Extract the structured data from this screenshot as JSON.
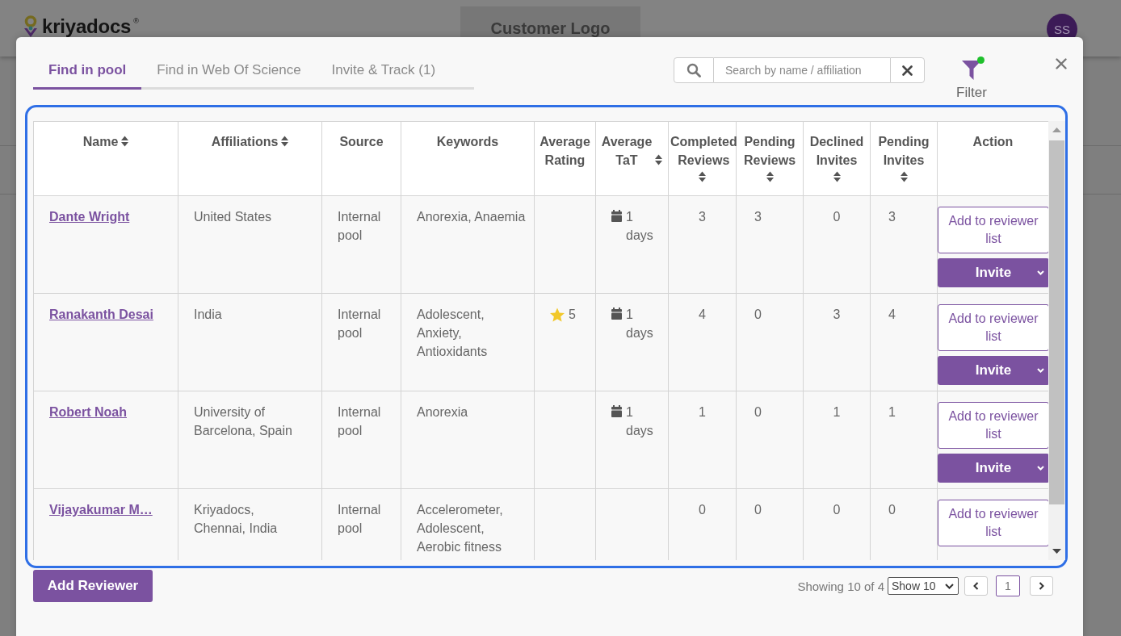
{
  "background_page": {
    "logo": "kriyadocs",
    "logo_mark": "®",
    "customer_logo": "Customer Logo",
    "avatar": "SS"
  },
  "dialog": {
    "tabs": [
      {
        "label": "Find in pool",
        "selected": true
      },
      {
        "label": "Find in Web Of Science",
        "selected": false
      },
      {
        "label": "Invite & Track (1)",
        "selected": false
      }
    ],
    "search": {
      "placeholder": "Search by name / affiliation"
    },
    "filter": {
      "label": "Filter",
      "active": true
    }
  },
  "table": {
    "columns": [
      {
        "label": "Name",
        "sortable": true
      },
      {
        "label": "Affiliations",
        "sortable": true
      },
      {
        "label": "Source",
        "sortable": false
      },
      {
        "label": "Keywords",
        "sortable": false
      },
      {
        "label": "Average Rating",
        "sortable": false
      },
      {
        "label": "Average TaT",
        "sortable": true
      },
      {
        "label": "Completed Reviews",
        "sortable": true
      },
      {
        "label": "Pending Reviews",
        "sortable": true
      },
      {
        "label": "Declined Invites",
        "sortable": true
      },
      {
        "label": "Pending Invites",
        "sortable": true
      },
      {
        "label": "Action",
        "sortable": false
      }
    ],
    "rows": [
      {
        "name": "Dante Wright",
        "affiliation": "United States",
        "source": "Internal pool",
        "keywords": "Anorexia, Anaemia",
        "tat": "1 days",
        "completed": "3",
        "pending_reviews": "3",
        "declined": "0",
        "pending_invites": "3",
        "actions": [
          {
            "kind": "outline",
            "label": "Add to reviewer list"
          },
          {
            "kind": "dropdown",
            "label": "Invite"
          }
        ]
      },
      {
        "name": "Ranakanth Desai",
        "affiliation": "India",
        "source": "Internal pool",
        "keywords": "Adolescent, Anxiety, Antioxidants",
        "rating": "5",
        "tat": "1 days",
        "completed": "4",
        "pending_reviews": "0",
        "declined": "3",
        "pending_invites": "4",
        "actions": [
          {
            "kind": "outline",
            "label": "Add to reviewer list"
          },
          {
            "kind": "dropdown",
            "label": "Invite"
          }
        ]
      },
      {
        "name": "Robert Noah",
        "affiliation": "University of Barcelona, Spain",
        "source": "Internal pool",
        "keywords": "Anorexia",
        "tat": "1 days",
        "completed": "1",
        "pending_reviews": "0",
        "declined": "1",
        "pending_invites": "1",
        "actions": [
          {
            "kind": "outline",
            "label": "Add to reviewer list"
          },
          {
            "kind": "dropdown",
            "label": "Invite"
          }
        ]
      },
      {
        "name": "Vijayakumar M…",
        "affiliation": "Kriyadocs, Chennai, India",
        "source": "Internal pool",
        "keywords": "Accelerometer, Adolescent, Aerobic fitness",
        "completed": "0",
        "pending_reviews": "0",
        "declined": "0",
        "pending_invites": "0",
        "actions": [
          {
            "kind": "outline",
            "label": "Add to reviewer list"
          }
        ]
      }
    ]
  },
  "footer": {
    "add_button": "Add Reviewer",
    "summary": "Showing 10 of 4",
    "page_size": "Show 10",
    "pages": [
      {
        "label": "1",
        "selected": true
      }
    ]
  }
}
